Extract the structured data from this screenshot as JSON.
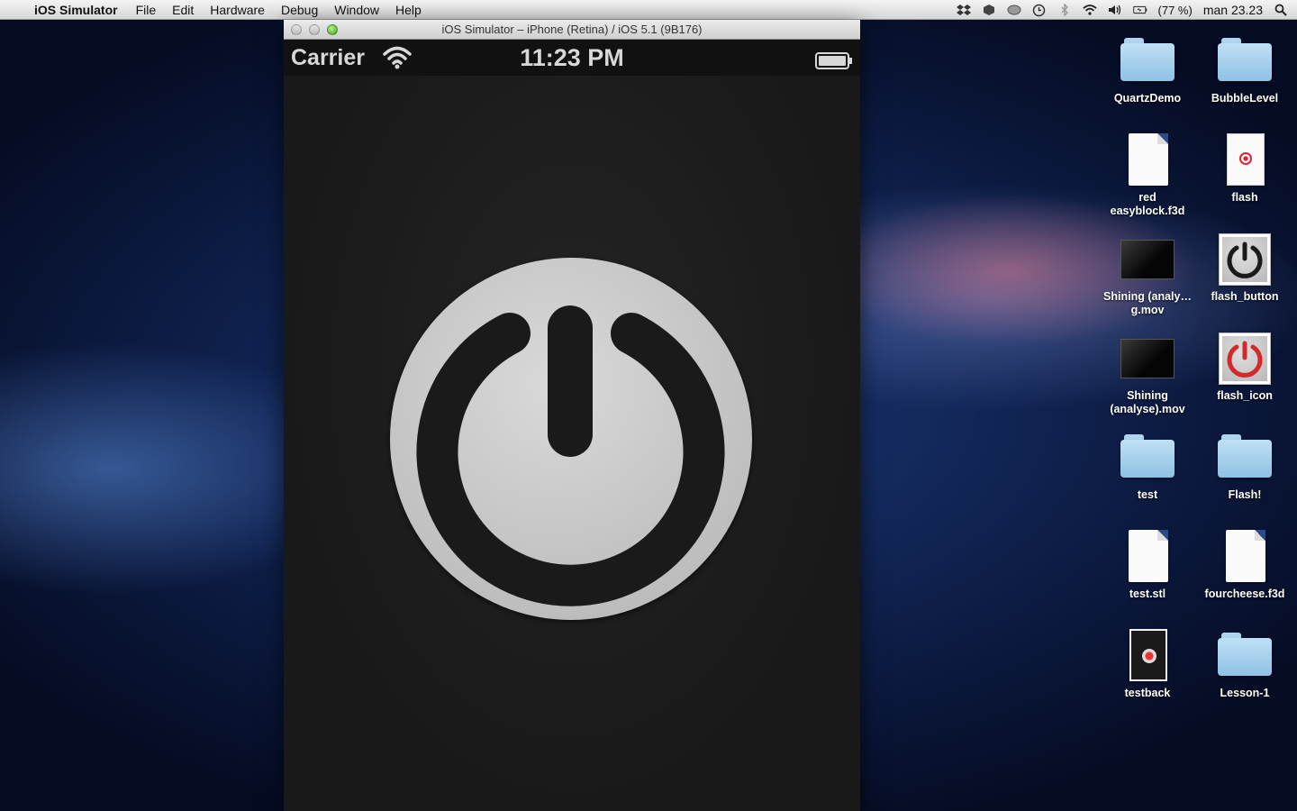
{
  "menubar": {
    "app_name": "iOS Simulator",
    "menus": [
      "File",
      "Edit",
      "Hardware",
      "Debug",
      "Window",
      "Help"
    ],
    "battery_percent": "(77 %)",
    "clock": "man 23.23"
  },
  "window": {
    "title": "iOS Simulator – iPhone (Retina) / iOS 5.1 (9B176)"
  },
  "ios_status": {
    "carrier": "Carrier",
    "time": "11:23 PM"
  },
  "desktop": {
    "icons": [
      {
        "label": "QuartzDemo",
        "kind": "folder"
      },
      {
        "label": "BubbleLevel",
        "kind": "folder"
      },
      {
        "label": "red easyblock.f3d",
        "kind": "document"
      },
      {
        "label": "flash",
        "kind": "document"
      },
      {
        "label": "Shining (analy…g.mov",
        "kind": "movie"
      },
      {
        "label": "flash_button",
        "kind": "image"
      },
      {
        "label": "Shining (analyse).mov",
        "kind": "movie"
      },
      {
        "label": "flash_icon",
        "kind": "image"
      },
      {
        "label": "test",
        "kind": "folder"
      },
      {
        "label": "Flash!",
        "kind": "folder"
      },
      {
        "label": "test.stl",
        "kind": "document"
      },
      {
        "label": "fourcheese.f3d",
        "kind": "document"
      },
      {
        "label": "testback",
        "kind": "image"
      },
      {
        "label": "Lesson-1",
        "kind": "folder"
      }
    ]
  },
  "colors": {
    "power_symbol_gray": "#1a1a1a",
    "power_symbol_red": "#d22a2a"
  }
}
